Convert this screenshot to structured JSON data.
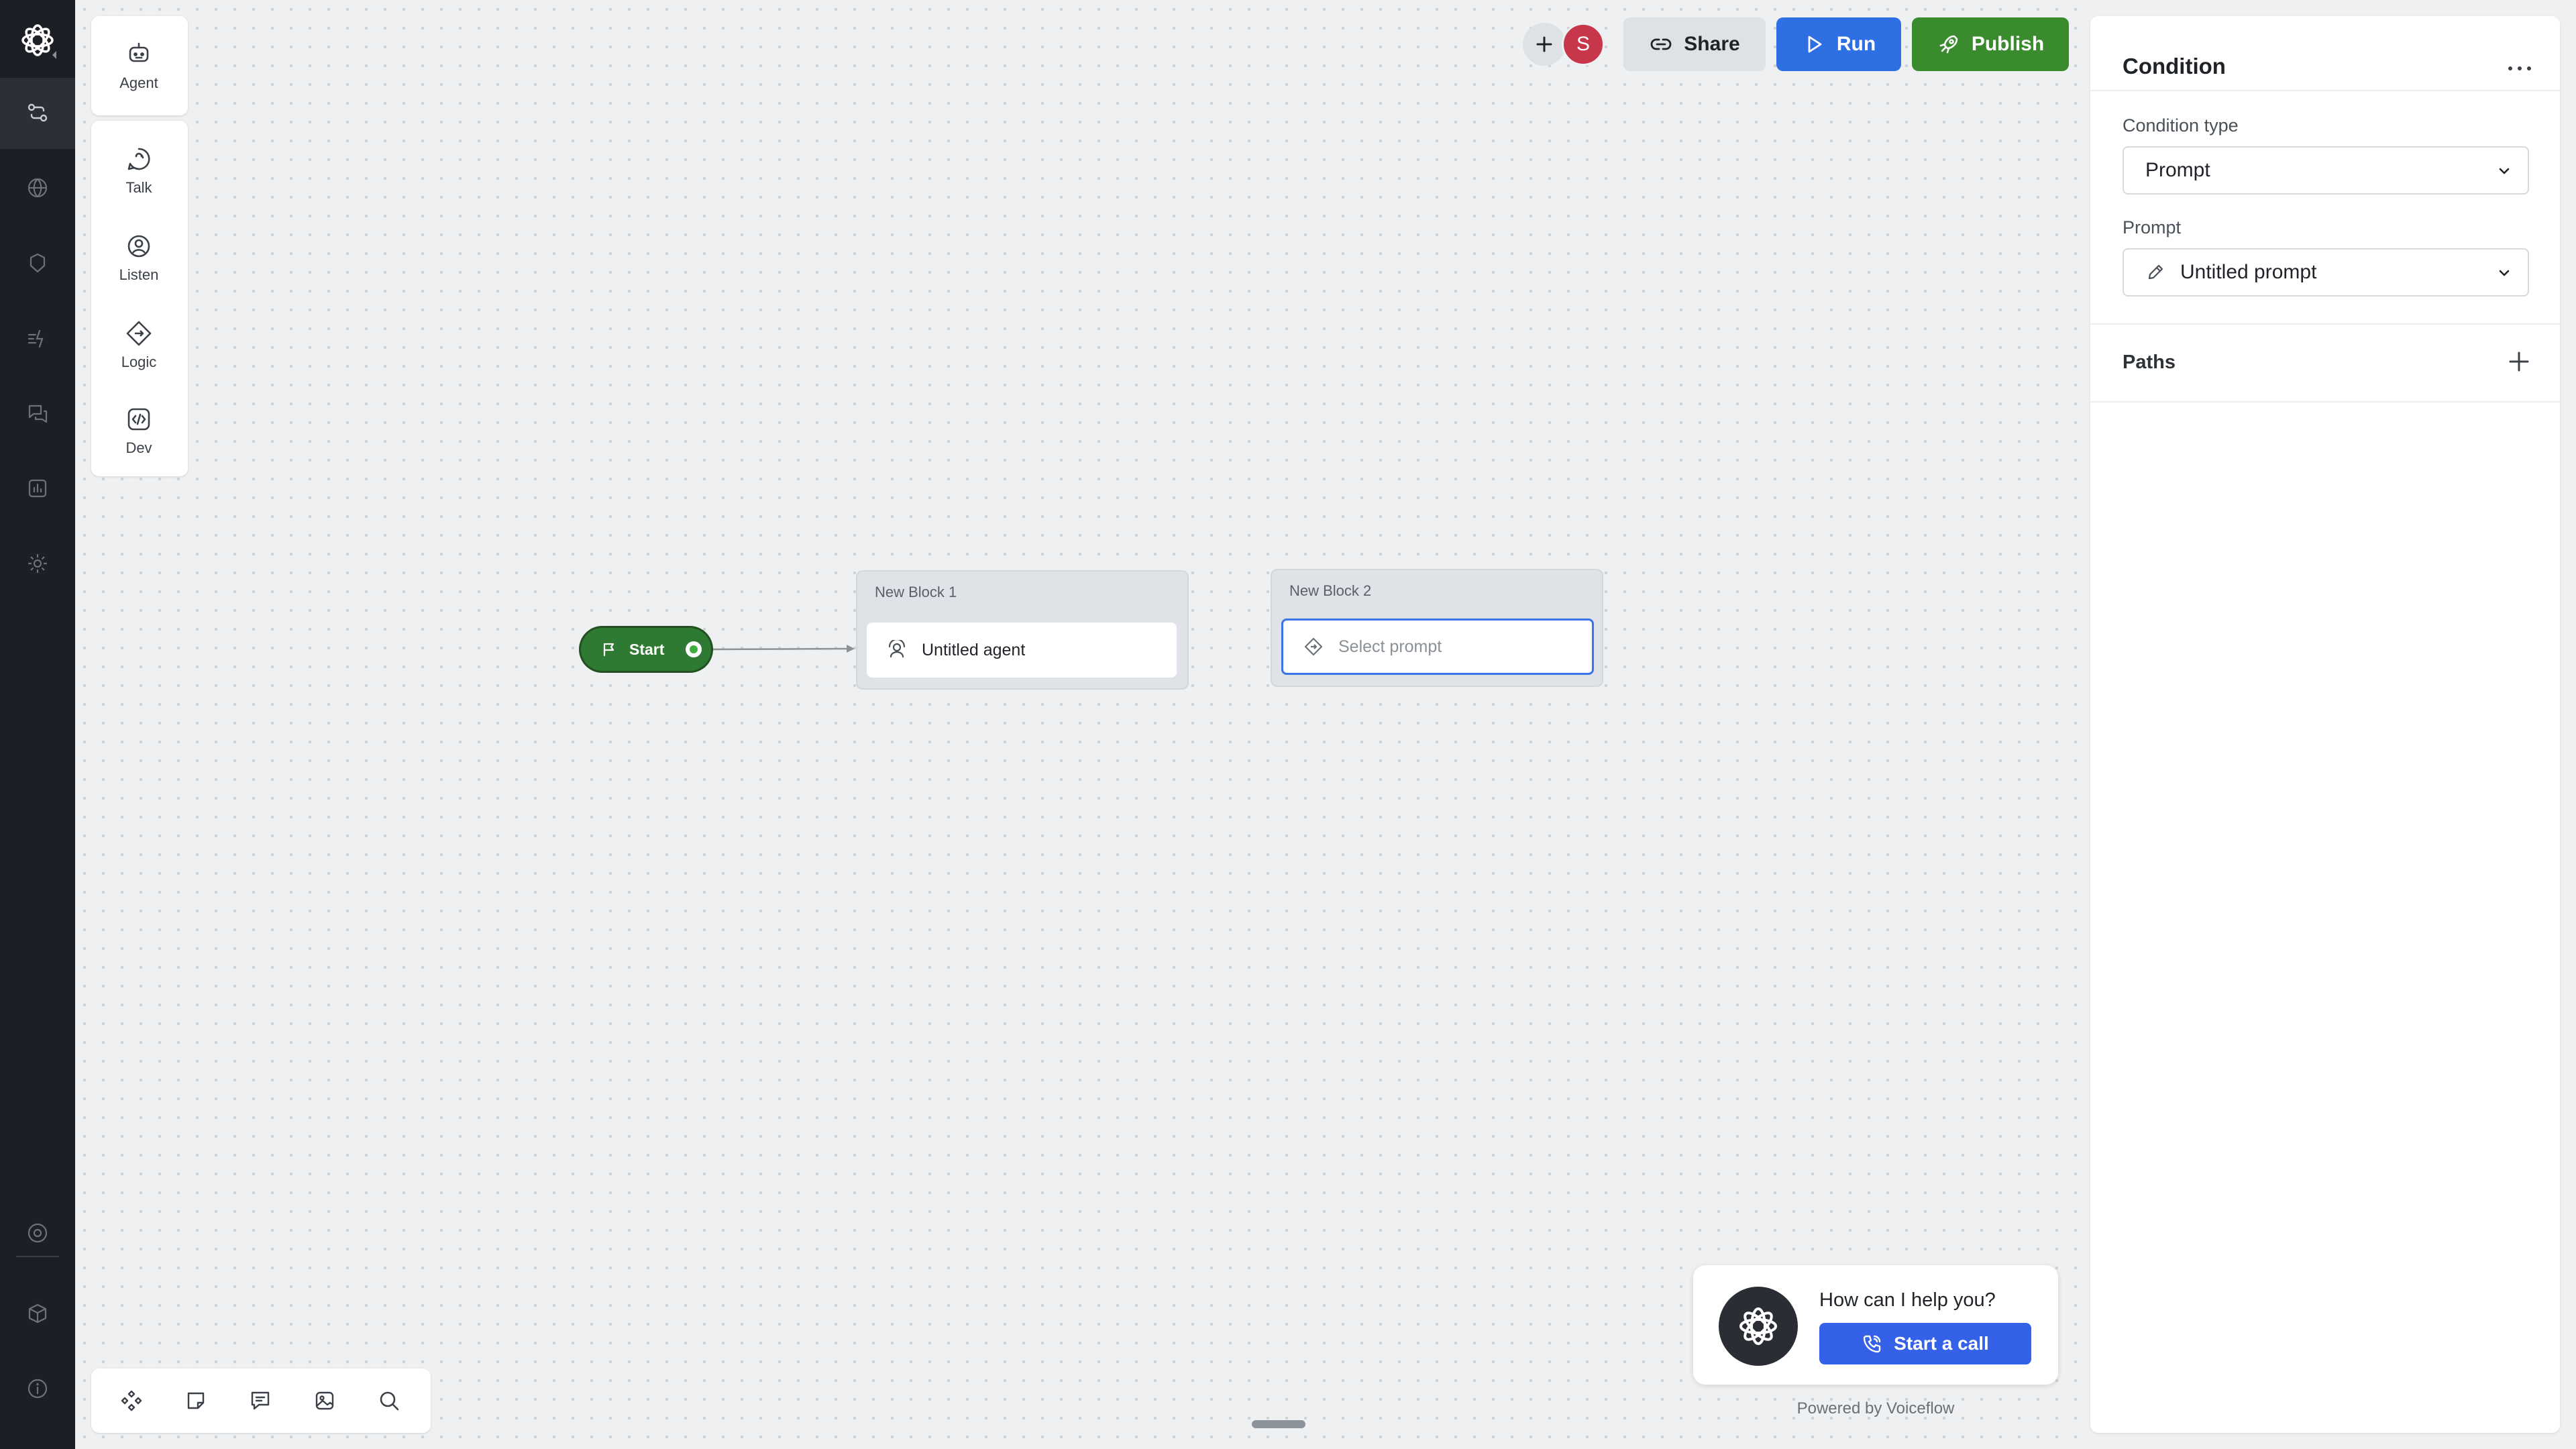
{
  "rail": {
    "items": [
      {
        "icon": "logo-icon"
      },
      {
        "icon": "workflows-icon",
        "active": true
      },
      {
        "icon": "knowledge-base-icon"
      },
      {
        "icon": "integrations-icon"
      },
      {
        "icon": "agents-icon"
      },
      {
        "icon": "conversations-icon"
      },
      {
        "icon": "analytics-icon"
      },
      {
        "icon": "settings-icon"
      },
      {
        "icon": "help-icon"
      },
      {
        "icon": "cube-icon"
      },
      {
        "icon": "info-icon"
      }
    ]
  },
  "palette": {
    "agent": "Agent",
    "talk": "Talk",
    "listen": "Listen",
    "logic": "Logic",
    "dev": "Dev"
  },
  "topbar": {
    "avatar_initial": "S",
    "share": "Share",
    "run": "Run",
    "publish": "Publish"
  },
  "canvas": {
    "start_label": "Start",
    "block1": {
      "title": "New Block 1",
      "step": "Untitled agent"
    },
    "block2": {
      "title": "New Block 2",
      "step_placeholder": "Select prompt"
    }
  },
  "chat_widget": {
    "question": "How can I help you?",
    "call_button": "Start a call",
    "powered_by": "Powered by Voiceflow"
  },
  "panel": {
    "title": "Condition",
    "condition_type_label": "Condition type",
    "condition_type_value": "Prompt",
    "prompt_label": "Prompt",
    "prompt_value": "Untitled prompt",
    "paths_label": "Paths"
  },
  "colors": {
    "rail_bg": "#1c2026",
    "canvas_bg": "#eef0f1",
    "run_blue": "#2f6fe4",
    "publish_green": "#3a8a2e",
    "start_green": "#2f7a32",
    "call_blue": "#3560e8",
    "avatar_red": "#c7364b"
  }
}
